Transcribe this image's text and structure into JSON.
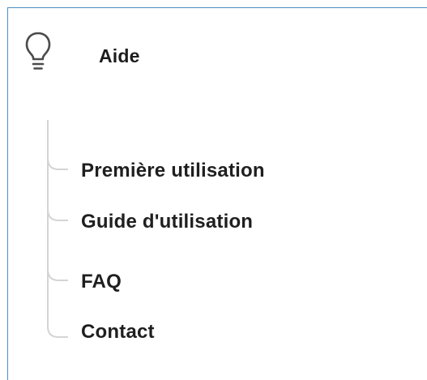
{
  "section": {
    "title": "Aide",
    "icon": "lightbulb-icon"
  },
  "menu": {
    "items": [
      {
        "label": "Première utilisation"
      },
      {
        "label": "Guide d'utilisation"
      },
      {
        "label": "FAQ"
      },
      {
        "label": "Contact"
      }
    ]
  },
  "colors": {
    "panel_border": "#4a8fc7",
    "tree_line": "#d4d4d4",
    "text": "#1f1f1f"
  }
}
